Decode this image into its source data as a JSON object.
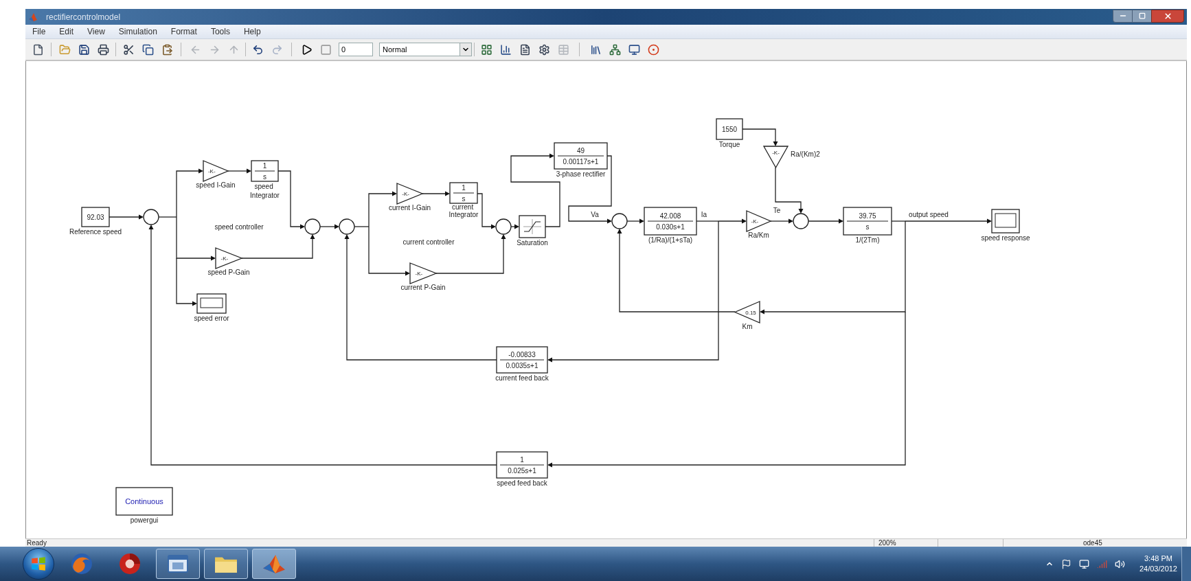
{
  "window": {
    "title": "rectifiercontrolmodel"
  },
  "menu": [
    "File",
    "Edit",
    "View",
    "Simulation",
    "Format",
    "Tools",
    "Help"
  ],
  "toolbar": {
    "buttons": [
      {
        "disabled": false
      },
      {
        "disabled": false
      },
      {
        "disabled": false
      },
      {
        "disabled": false
      },
      {
        "disabled": false
      },
      {
        "disabled": false
      },
      {
        "disabled": false
      },
      {
        "disabled": true
      },
      {
        "disabled": true
      },
      {
        "disabled": true
      },
      {
        "disabled": false
      },
      {
        "disabled": true
      },
      {
        "disabled": false
      },
      {
        "disabled": true
      },
      {
        "disabled": false
      },
      {
        "disabled": false
      },
      {
        "disabled": false
      },
      {
        "disabled": false
      },
      {
        "disabled": true
      },
      {
        "disabled": false
      },
      {
        "disabled": false
      },
      {
        "disabled": false
      },
      {
        "disabled": false
      }
    ],
    "stop_time": "0",
    "mode": "Normal"
  },
  "diagram": {
    "blocks": [
      {
        "kind": "constant",
        "value": "92.03",
        "label": "Reference speed"
      },
      {
        "kind": "sum"
      },
      {
        "kind": "gain",
        "value": "-K-",
        "label": "speed I-Gain"
      },
      {
        "kind": "integrator",
        "numerator": "1",
        "denominator": "s",
        "label": "speed Integrator"
      },
      {
        "kind": "gain",
        "value": "-K-",
        "label": "speed P-Gain"
      },
      {
        "kind": "scope",
        "label": "speed error"
      },
      {
        "kind": "sum"
      },
      {
        "kind": "sum"
      },
      {
        "kind": "gain",
        "value": "-K-",
        "label": "current I-Gain"
      },
      {
        "kind": "integrator",
        "numerator": "1",
        "denominator": "s",
        "label": "current Integrator"
      },
      {
        "kind": "gain",
        "value": "-K-",
        "label": "current P-Gain"
      },
      {
        "kind": "sum"
      },
      {
        "kind": "saturation",
        "label": "Saturation"
      },
      {
        "kind": "transfer_fcn",
        "numerator": "49",
        "denominator": "0.00117s+1",
        "label": "3-phase rectifier"
      },
      {
        "kind": "sum"
      },
      {
        "kind": "transfer_fcn",
        "numerator": "42.008",
        "denominator": "0.030s+1",
        "label": "(1/Ra)/(1+sTa)"
      },
      {
        "kind": "constant",
        "value": "1550",
        "label": "Torque"
      },
      {
        "kind": "gain",
        "value": "-K-",
        "label": "Ra/(Km)2"
      },
      {
        "kind": "gain",
        "value": "-K-",
        "label": "Ra/Km"
      },
      {
        "kind": "sum"
      },
      {
        "kind": "transfer_fcn",
        "numerator": "39.75",
        "denominator": "s",
        "label": "1/(2Tm)"
      },
      {
        "kind": "scope",
        "label": "speed response"
      },
      {
        "kind": "gain",
        "value": "0.15",
        "label": "Km"
      },
      {
        "kind": "transfer_fcn",
        "numerator": "-0.00833",
        "denominator": "0.0035s+1",
        "label": "current feed back"
      },
      {
        "kind": "transfer_fcn",
        "numerator": "1",
        "denominator": "0.025s+1",
        "label": "speed feed back"
      },
      {
        "kind": "powergui",
        "value": "Continuous",
        "label": "powergui"
      }
    ],
    "annotations": [
      "speed controller",
      "current controller"
    ],
    "signal_labels": [
      "Va",
      "Ia",
      "Te",
      "output speed"
    ]
  },
  "status_bar": [
    "Ready",
    "200%",
    "ode45"
  ],
  "taskbar": {
    "apps": [
      {
        "running": false,
        "selected": false
      },
      {
        "running": false,
        "selected": false
      },
      {
        "running": true,
        "selected": false
      },
      {
        "running": true,
        "selected": false
      },
      {
        "running": true,
        "selected": true
      }
    ],
    "time": "3:48 PM",
    "date": "24/03/2012"
  }
}
